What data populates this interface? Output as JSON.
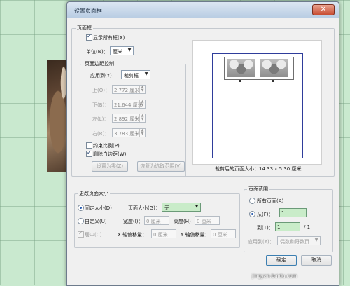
{
  "dialog": {
    "title": "设置页面框",
    "close_glyph": "✕"
  },
  "page_box": {
    "group_title": "页面框",
    "show_all_boxes": "显示所有框(X)",
    "unit_label": "单位(N)：",
    "unit_value": "厘米",
    "margin_group": "页面边距控制",
    "apply_to_label": "应用到(Y)：",
    "apply_to_value": "裁剪框",
    "top_label": "上(O)：",
    "top_value": "2.772 厘米",
    "bottom_label": "下(B)：",
    "bottom_value": "21.644 厘米",
    "left_label": "左(L)：",
    "left_value": "2.892 厘米",
    "right_label": "右(R)：",
    "right_value": "3.783 厘米",
    "constrain": "约束比例(P)",
    "remove_white": "删除白边距(W)",
    "set_zero_btn": "设置为零(Z)",
    "revert_btn": "恢复为选取范围(V)",
    "preview_caption": "裁剪后的页面大小：14.33 x 5.30 厘米"
  },
  "change_size": {
    "group_title": "更改页面大小",
    "fixed_size": "固定大小(D)",
    "page_size_label": "页面大小(G)：",
    "page_size_value": "无",
    "custom": "自定义(U)",
    "width_label": "宽度(I)：",
    "width_value": "0 厘米",
    "height_label": "高度(H)：",
    "height_value": "0 厘米",
    "center": "居中(C)",
    "x_offset_label": "X 轴偏移量：",
    "x_offset_value": "0 厘米",
    "y_offset_label": "Y 轴偏移量：",
    "y_offset_value": "0 厘米"
  },
  "page_range": {
    "group_title": "页面范围",
    "all_pages": "所有页面(A)",
    "from_label": "从(F)：",
    "from_value": "1",
    "to_label": "到(T)：",
    "to_value": "1",
    "total": "/ 1",
    "apply_to_label": "应用到(Y)：",
    "apply_to_value": "偶数和奇数页"
  },
  "buttons": {
    "ok": "确定",
    "cancel": "取消"
  },
  "watermark": "jingyan.baidu.com"
}
